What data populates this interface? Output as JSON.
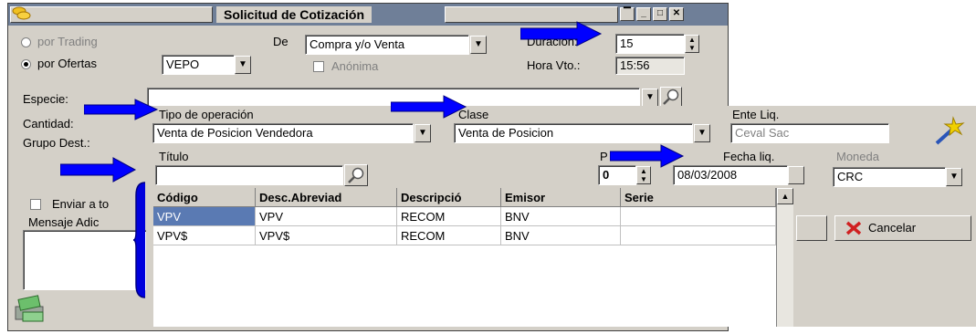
{
  "window": {
    "title": "Solicitud de Cotización"
  },
  "left": {
    "radio_trading": "por Trading",
    "radio_ofertas": "por Ofertas",
    "ofertas_value": "VEPO",
    "de_label": "De",
    "de_value": "Compra y/o Venta",
    "anonima": "Anónima",
    "duracion_label": "Duración:",
    "duracion_value": "15",
    "hora_label": "Hora Vto.:",
    "hora_value": "15:56",
    "especie_label": "Especie:",
    "cantidad_label": "Cantidad:",
    "grupo_label": "Grupo Dest.:",
    "enviar_label": "Enviar a to",
    "mensaje_label": "Mensaje Adic"
  },
  "overlay": {
    "tipo_label": "Tipo de operación",
    "tipo_value": "Venta de Posicion Vendedora",
    "clase_label": "Clase",
    "clase_value": "Venta de Posicion",
    "ente_label": "Ente Liq.",
    "ente_value": "Ceval Sac",
    "titulo_label": "Título",
    "titulo_value": "",
    "p_label": "P",
    "p_value": "0",
    "fecha_label": "Fecha liq.",
    "fecha_value": "08/03/2008",
    "moneda_label": "Moneda",
    "moneda_value": "CRC",
    "cancel_label": "Cancelar"
  },
  "grid": {
    "headers": [
      "Código",
      "Desc.Abreviad",
      "Descripció",
      "Emisor",
      "Serie"
    ],
    "rows": [
      [
        "VPV",
        "VPV",
        "RECOM",
        "BNV",
        ""
      ],
      [
        "VPV$",
        "VPV$",
        "RECOM",
        "BNV",
        ""
      ]
    ]
  },
  "colors": {
    "titlebar": "#6f7f98",
    "arrow": "#0000ff",
    "selection": "#5a7ab3"
  }
}
